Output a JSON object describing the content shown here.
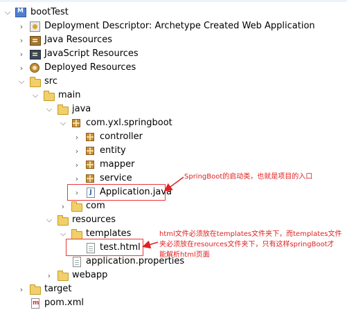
{
  "tree": {
    "project": "bootTest",
    "deployment_descriptor": "Deployment Descriptor: Archetype Created Web Application",
    "java_resources": "Java Resources",
    "javascript_resources": "JavaScript Resources",
    "deployed_resources": "Deployed Resources",
    "src": "src",
    "main": "main",
    "java": "java",
    "package_root": "com.yxl.springboot",
    "controller": "controller",
    "entity": "entity",
    "mapper": "mapper",
    "service": "service",
    "application_java": "Application.java",
    "com": "com",
    "resources": "resources",
    "templates": "templates",
    "test_html": "test.html",
    "application_properties": "application.properties",
    "webapp": "webapp",
    "target": "target",
    "pom": "pom.xml"
  },
  "annotations": {
    "app_note": "SpringBoot的启动类，也就是项目的入口",
    "html_note_line1": "html文件必须放在templates文件夹下，而templates文件",
    "html_note_line2": "夹必须放在resources文件夹下，只有这样springBoot才",
    "html_note_line3": "能解析html页面"
  },
  "colors": {
    "annotation": "#e02020",
    "folder": "#f1cf6a",
    "package": "#c9903a"
  }
}
